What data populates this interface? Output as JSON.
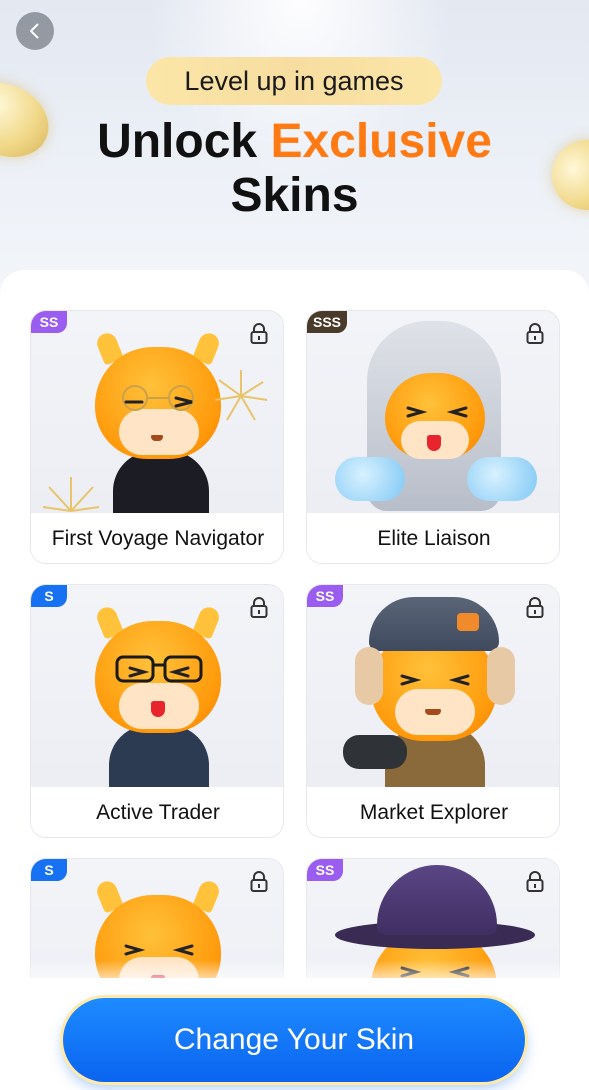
{
  "header": {
    "pill_text": "Level up in games",
    "headline_part1": "Unlock ",
    "headline_accent": "Exclusive",
    "headline_part2": "Skins"
  },
  "colors": {
    "accent": "#ff7a12",
    "cta": "#0a64f0",
    "badge_ss": "#9b5cf0",
    "badge_sss": "#4a3a2a",
    "badge_s": "#1672f3"
  },
  "skins": [
    {
      "name": "First Voyage Navigator",
      "tier": "SS",
      "locked": true
    },
    {
      "name": "Elite Liaison",
      "tier": "SSS",
      "locked": true
    },
    {
      "name": "Active Trader",
      "tier": "S",
      "locked": true
    },
    {
      "name": "Market Explorer",
      "tier": "SS",
      "locked": true
    },
    {
      "name": "",
      "tier": "S",
      "locked": true
    },
    {
      "name": "",
      "tier": "SS",
      "locked": true
    }
  ],
  "cta": {
    "label": "Change Your Skin"
  },
  "icons": {
    "back": "chevron-left-icon",
    "lock": "lock-icon"
  }
}
